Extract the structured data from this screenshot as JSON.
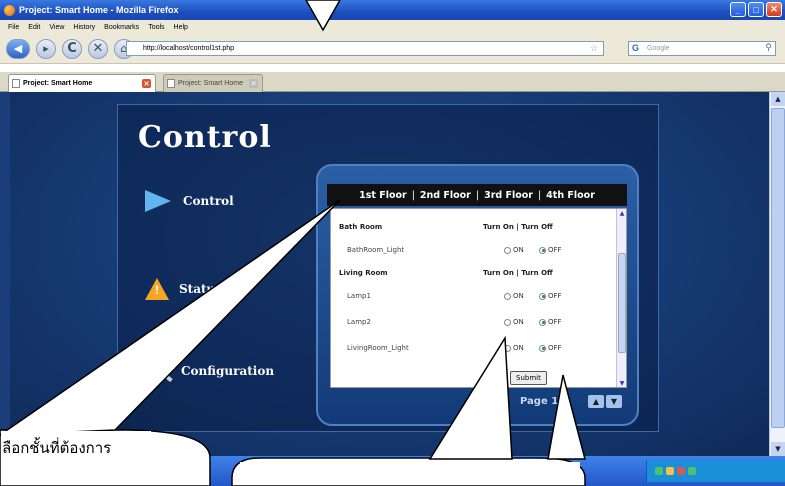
{
  "window": {
    "title": "Project: Smart Home - Mozilla Firefox",
    "min": "_",
    "max": "□",
    "close": "✕"
  },
  "menu": [
    "File",
    "Edit",
    "View",
    "History",
    "Bookmarks",
    "Tools",
    "Help"
  ],
  "nav": {
    "url": "http://localhost/control1st.php",
    "search_placeholder": "Google"
  },
  "tabs": [
    {
      "label": "Project: Smart Home"
    },
    {
      "label": "Project: Smart Home"
    }
  ],
  "page": {
    "title": "Control",
    "menu": [
      {
        "label": "Control",
        "icon": "arrow-icon"
      },
      {
        "label": "Status",
        "icon": "warning-icon"
      },
      {
        "label": "Configuration",
        "icon": "wrench-icon"
      }
    ],
    "floor_tabs": [
      "1st Floor",
      "2nd Floor",
      "3rd Floor",
      "4th Floor"
    ],
    "rooms": [
      {
        "name": "Bath Room",
        "header_actions": "Turn On | Turn Off",
        "devices": [
          {
            "name": "BathRoom_Light",
            "state": "off"
          }
        ]
      },
      {
        "name": "Living Room",
        "header_actions": "Turn On | Turn Off",
        "devices": [
          {
            "name": "Lamp1",
            "state": "off"
          },
          {
            "name": "Lamp2",
            "state": "off"
          },
          {
            "name": "LivingRoom_Light",
            "state": "off"
          }
        ]
      }
    ],
    "radio_on_label": "ON",
    "radio_off_label": "OFF",
    "submit_label": "Submit",
    "page_indicator": "Page 1/2"
  },
  "annotation": {
    "caption": "ลือกชั้นที่ต้องการ"
  },
  "colors": {
    "page_bg": "#163a73",
    "accent": "#64b4f0",
    "warning": "#f5a623"
  }
}
